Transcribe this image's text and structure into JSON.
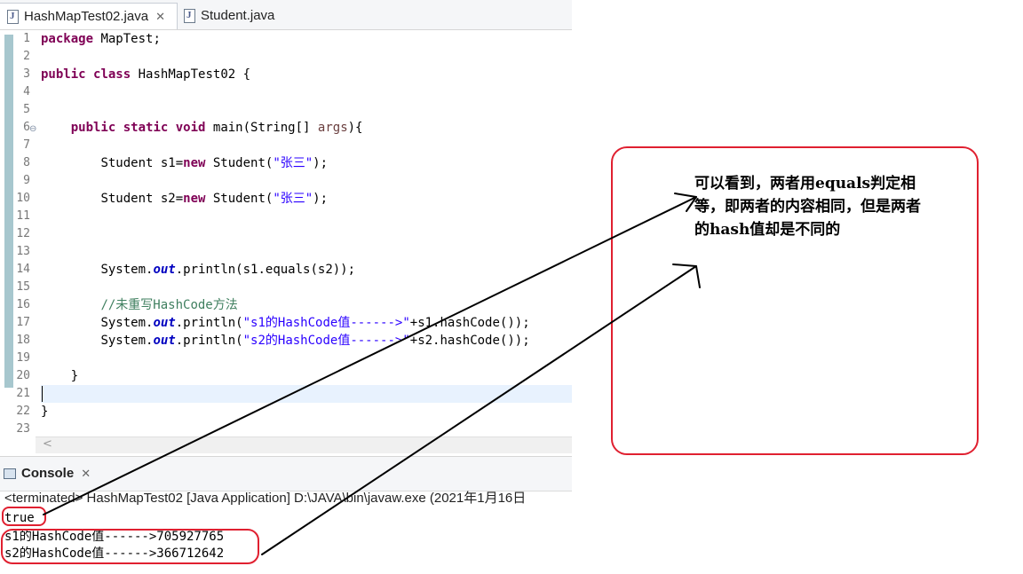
{
  "editor": {
    "tabs": [
      {
        "label": "HashMapTest02.java",
        "close": "✕"
      },
      {
        "label": "Student.java"
      }
    ],
    "lines": [
      {
        "num": "1"
      },
      {
        "num": "2"
      },
      {
        "num": "3"
      },
      {
        "num": "4"
      },
      {
        "num": "5"
      },
      {
        "num": "6",
        "fold": "⊖"
      },
      {
        "num": "7"
      },
      {
        "num": "8"
      },
      {
        "num": "9"
      },
      {
        "num": "10"
      },
      {
        "num": "11"
      },
      {
        "num": "12"
      },
      {
        "num": "13"
      },
      {
        "num": "14"
      },
      {
        "num": "15"
      },
      {
        "num": "16"
      },
      {
        "num": "17"
      },
      {
        "num": "18"
      },
      {
        "num": "19"
      },
      {
        "num": "20"
      },
      {
        "num": "21"
      },
      {
        "num": "22"
      },
      {
        "num": "23"
      }
    ],
    "code": {
      "l1_kw": "package",
      "l1_rest": " MapTest;",
      "l3_kw1": "public",
      "l3_kw2": "class",
      "l3_rest": " HashMapTest02 {",
      "l6_kw1": "public",
      "l6_kw2": "static",
      "l6_kw3": "void",
      "l6_a": " main(String[] ",
      "l6_param": "args",
      "l6_b": "){",
      "l8_a": "Student s1=",
      "l8_kw": "new",
      "l8_b": " Student(",
      "l8_str": "\"张三\"",
      "l8_c": ");",
      "l10_a": "Student s2=",
      "l10_kw": "new",
      "l10_b": " Student(",
      "l10_str": "\"张三\"",
      "l10_c": ");",
      "l14_a": "System.",
      "l14_out": "out",
      "l14_b": ".println(s1.equals(s2));",
      "l16_cmt": "//未重写HashCode方法",
      "l17_a": "System.",
      "l17_out": "out",
      "l17_b": ".println(",
      "l17_str": "\"s1的HashCode值------>\"",
      "l17_c": "+s1.hashCode());",
      "l18_a": "System.",
      "l18_out": "out",
      "l18_b": ".println(",
      "l18_str": "\"s2的HashCode值------>\"",
      "l18_c": "+s2.hashCode());",
      "l20": "}",
      "l22": "}"
    },
    "scroll_left": "<"
  },
  "console": {
    "title": "Console",
    "close": "✕",
    "terminated": "<terminated> HashMapTest02 [Java Application] D:\\JAVA\\bin\\javaw.exe (2021年1月16日",
    "output": [
      "true",
      "s1的HashCode值------>705927765",
      "s2的HashCode值------>366712642"
    ]
  },
  "annotation": {
    "text": "可以看到，两者用equals判定相等，即两者的内容相同，但是两者的hash值却是不同的",
    "box_color": "#e02030",
    "arrow_color": "#000000"
  }
}
